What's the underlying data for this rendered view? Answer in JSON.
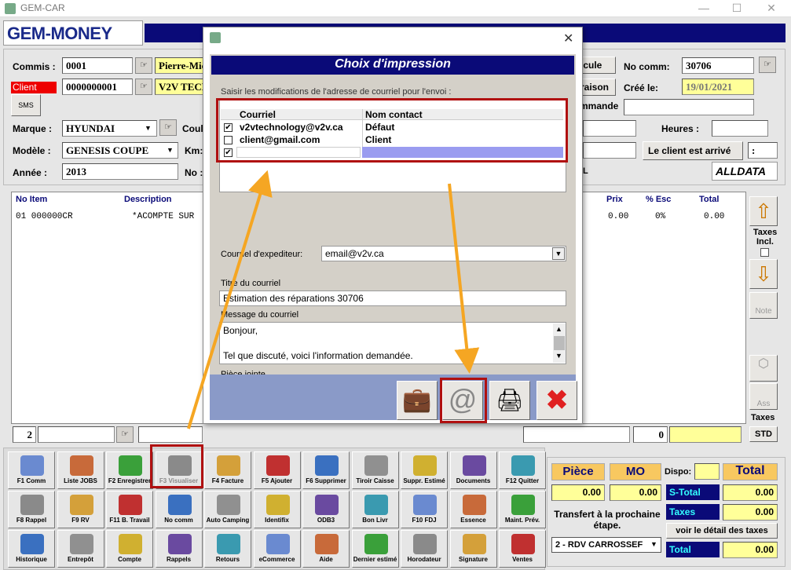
{
  "window": {
    "title": "GEM-CAR"
  },
  "brand": {
    "logo": "GEM-MONEY"
  },
  "form": {
    "commis_label": "Commis :",
    "commis_value": "0001",
    "commis_name": "Pierre-Mic",
    "client_label": "Client",
    "client_value": "0000000001",
    "client_name": "V2V TECH",
    "marque_label": "Marque :",
    "marque_value": "HYUNDAI",
    "modele_label": "Modèle :",
    "modele_value": "GENESIS COUPE",
    "annee_label": "Année :",
    "annee_value": "2013",
    "coul_label": "Coul",
    "km_label": "Km:",
    "no_label": "No :",
    "vehicule_label": "icule",
    "livraison_label": "raison",
    "commande_label": "mmande",
    "no_comm_label": "No comm:",
    "no_comm_value": "30706",
    "cree_label": "Créé le:",
    "cree_value": "19/01/2021",
    "heures_label": "Heures :",
    "client_arrive_button": "Le client est arrivé",
    "colon_field": ":",
    "alldata": "ALLDATA",
    "l_text": "L"
  },
  "grid": {
    "headers": [
      "No Item",
      "Description",
      "Prix",
      "% Esc",
      "Total"
    ],
    "row": {
      "no": "01  000000CR",
      "desc": "*ACOMPTE SUR",
      "prix": "0.00",
      "esc": "0%",
      "total": "0.00"
    }
  },
  "side": {
    "taxes_incl": "Taxes Incl.",
    "note": "Note",
    "ass": "Ass",
    "taxes": "Taxes",
    "std": "STD"
  },
  "footer": {
    "qty": "2",
    "zero": "0"
  },
  "toolbar": {
    "row1": [
      "F1 Comm",
      "Liste JOBS",
      "F2 Enregistrer",
      "F3 Visualiser",
      "F4 Facture",
      "F5 Ajouter",
      "F6 Supprimer",
      "Tiroir Caisse",
      "Suppr. Estimé",
      "Documents",
      "F12 Quitter"
    ],
    "row2": [
      "F8 Rappel",
      "F9 RV",
      "F11 B. Travail",
      "No comm",
      "Auto Camping",
      "Identifix",
      "ODB3",
      "Bon Livr",
      "F10 FDJ",
      "Essence",
      "Maint. Prév."
    ],
    "row3": [
      "Historique",
      "Entrepôt",
      "Compte",
      "Rappels",
      "Retours",
      "eCommerce",
      "Aide",
      "Dernier estimé",
      "Horodateur",
      "Signature",
      "Ventes"
    ]
  },
  "totals": {
    "piece_label": "Pièce",
    "mo_label": "MO",
    "dispo_label": "Dispo:",
    "total_label": "Total",
    "piece_value": "0.00",
    "mo_value": "0.00",
    "stotal_label": "S-Total",
    "stotal_value": "0.00",
    "transfert_label": "Transfert à la prochaine étape.",
    "taxes_label": "Taxes",
    "taxes_value": "0.00",
    "detail_button": "voir le détail des taxes",
    "step_value": "2 - RDV CARROSSEF",
    "total2_label": "Total",
    "total2_value": "0.00"
  },
  "dialog": {
    "title": "Choix d'impression",
    "instruction": "Saisir les modifications de l'adresse de courriel pour l'envoi :",
    "col_courriel": "Courriel",
    "col_contact": "Nom contact",
    "rows": [
      {
        "email": "v2vtechnology@v2v.ca",
        "contact": "Défaut",
        "checked": true
      },
      {
        "email": "client@gmail.com",
        "contact": "Client",
        "checked": false
      },
      {
        "email": "",
        "contact": "",
        "checked": true
      }
    ],
    "sender_label": "Courriel d'expediteur:",
    "sender_value": "email@v2v.ca",
    "subject_label": "Titre du courriel",
    "subject_value": "Estimation des réparations 30706",
    "message_label": "Message du courriel",
    "message_line1": "Bonjour,",
    "message_line2": "Tel que discuté, voici l'information demandée.",
    "attachment_label": "Pièce jointe",
    "attachment_value": "",
    "close": "✕"
  },
  "colors": {
    "accent": "#0a0a78",
    "highlight": "#b01010",
    "arrow": "#f5a623"
  }
}
